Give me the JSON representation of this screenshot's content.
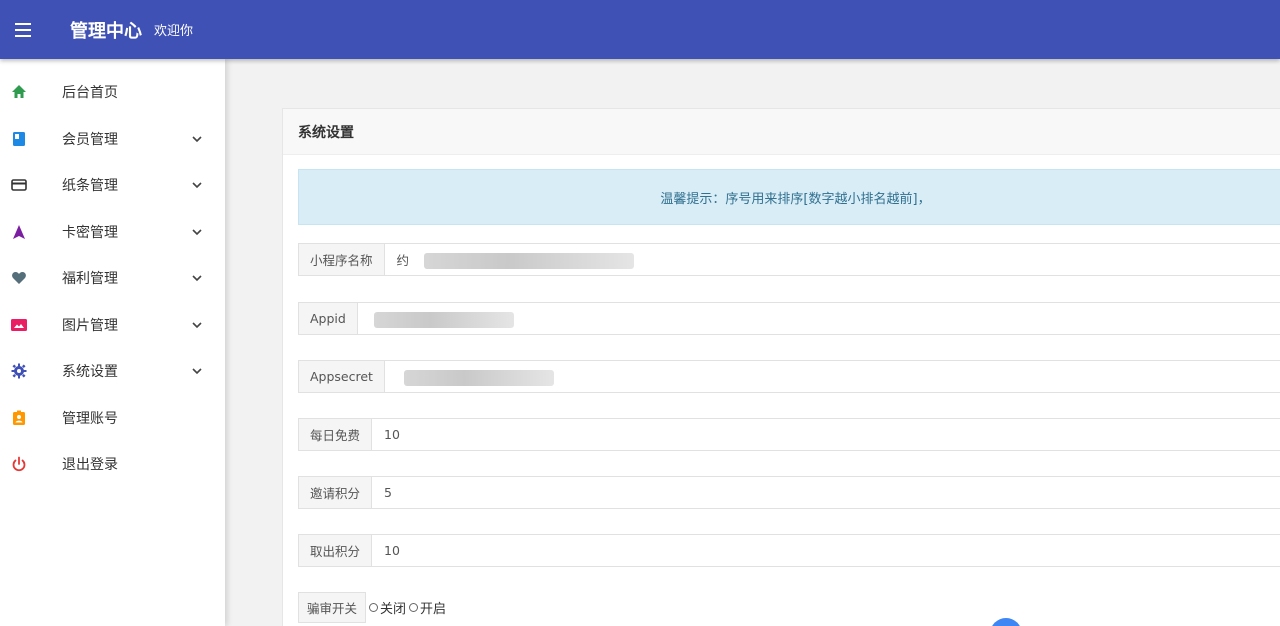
{
  "header": {
    "title": "管理中心",
    "welcome": "欢迎你"
  },
  "sidebar": {
    "items": [
      {
        "label": "后台首页",
        "icon": "home-icon",
        "color": "#2e9b4f",
        "has_sub": false
      },
      {
        "label": "会员管理",
        "icon": "book-icon",
        "color": "#1e88e5",
        "has_sub": true
      },
      {
        "label": "纸条管理",
        "icon": "card-icon",
        "color": "#333333",
        "has_sub": true
      },
      {
        "label": "卡密管理",
        "icon": "navigation-arrow-icon",
        "color": "#7b1fa2",
        "has_sub": true
      },
      {
        "label": "福利管理",
        "icon": "heart-icon",
        "color": "#546e7a",
        "has_sub": true
      },
      {
        "label": "图片管理",
        "icon": "image-icon",
        "color": "#e91e63",
        "has_sub": true
      },
      {
        "label": "系统设置",
        "icon": "gear-icon",
        "color": "#3f51b5",
        "has_sub": true
      },
      {
        "label": "管理账号",
        "icon": "account-badge-icon",
        "color": "#ff9800",
        "has_sub": false
      },
      {
        "label": "退出登录",
        "icon": "power-icon",
        "color": "#e53935",
        "has_sub": false
      }
    ]
  },
  "main": {
    "card_title": "系统设置",
    "tip": "温馨提示：序号用来排序[数字越小排名越前]，",
    "fields": [
      {
        "label": "小程序名称",
        "value": "约"
      },
      {
        "label": "Appid",
        "value": ""
      },
      {
        "label": "Appsecret",
        "value": ""
      },
      {
        "label": "每日免费",
        "value": "10"
      },
      {
        "label": "邀请积分",
        "value": "5"
      },
      {
        "label": "取出积分",
        "value": "10"
      }
    ],
    "switch": {
      "label": "骗审开关",
      "off_label": "关闭",
      "on_label": "开启"
    }
  }
}
